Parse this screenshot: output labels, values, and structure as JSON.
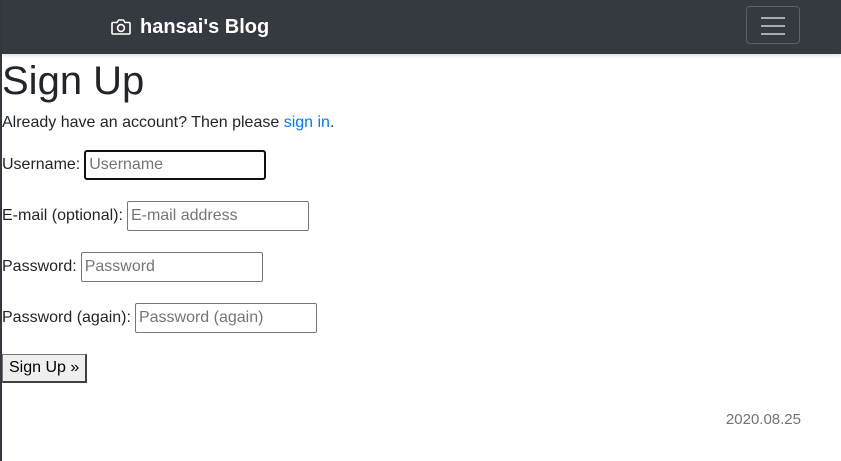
{
  "navbar": {
    "brand_icon": "camera-icon",
    "brand_text": "hansai's Blog",
    "toggler_icon": "hamburger-menu-icon",
    "background_color": "#343a40"
  },
  "page": {
    "title": "Sign Up",
    "intro_text": "Already have an account? Then please ",
    "intro_link": "sign in",
    "intro_end": ".",
    "link_color": "#007bff"
  },
  "form": {
    "username": {
      "label": "Username:",
      "placeholder": "Username",
      "value": ""
    },
    "email": {
      "label": "E-mail (optional):",
      "placeholder": "E-mail address",
      "value": ""
    },
    "password": {
      "label": "Password:",
      "placeholder": "Password",
      "value": ""
    },
    "password2": {
      "label": "Password (again):",
      "placeholder": "Password (again)",
      "value": ""
    },
    "submit_label": "Sign Up »"
  },
  "footer": {
    "date": "2020.08.25"
  }
}
